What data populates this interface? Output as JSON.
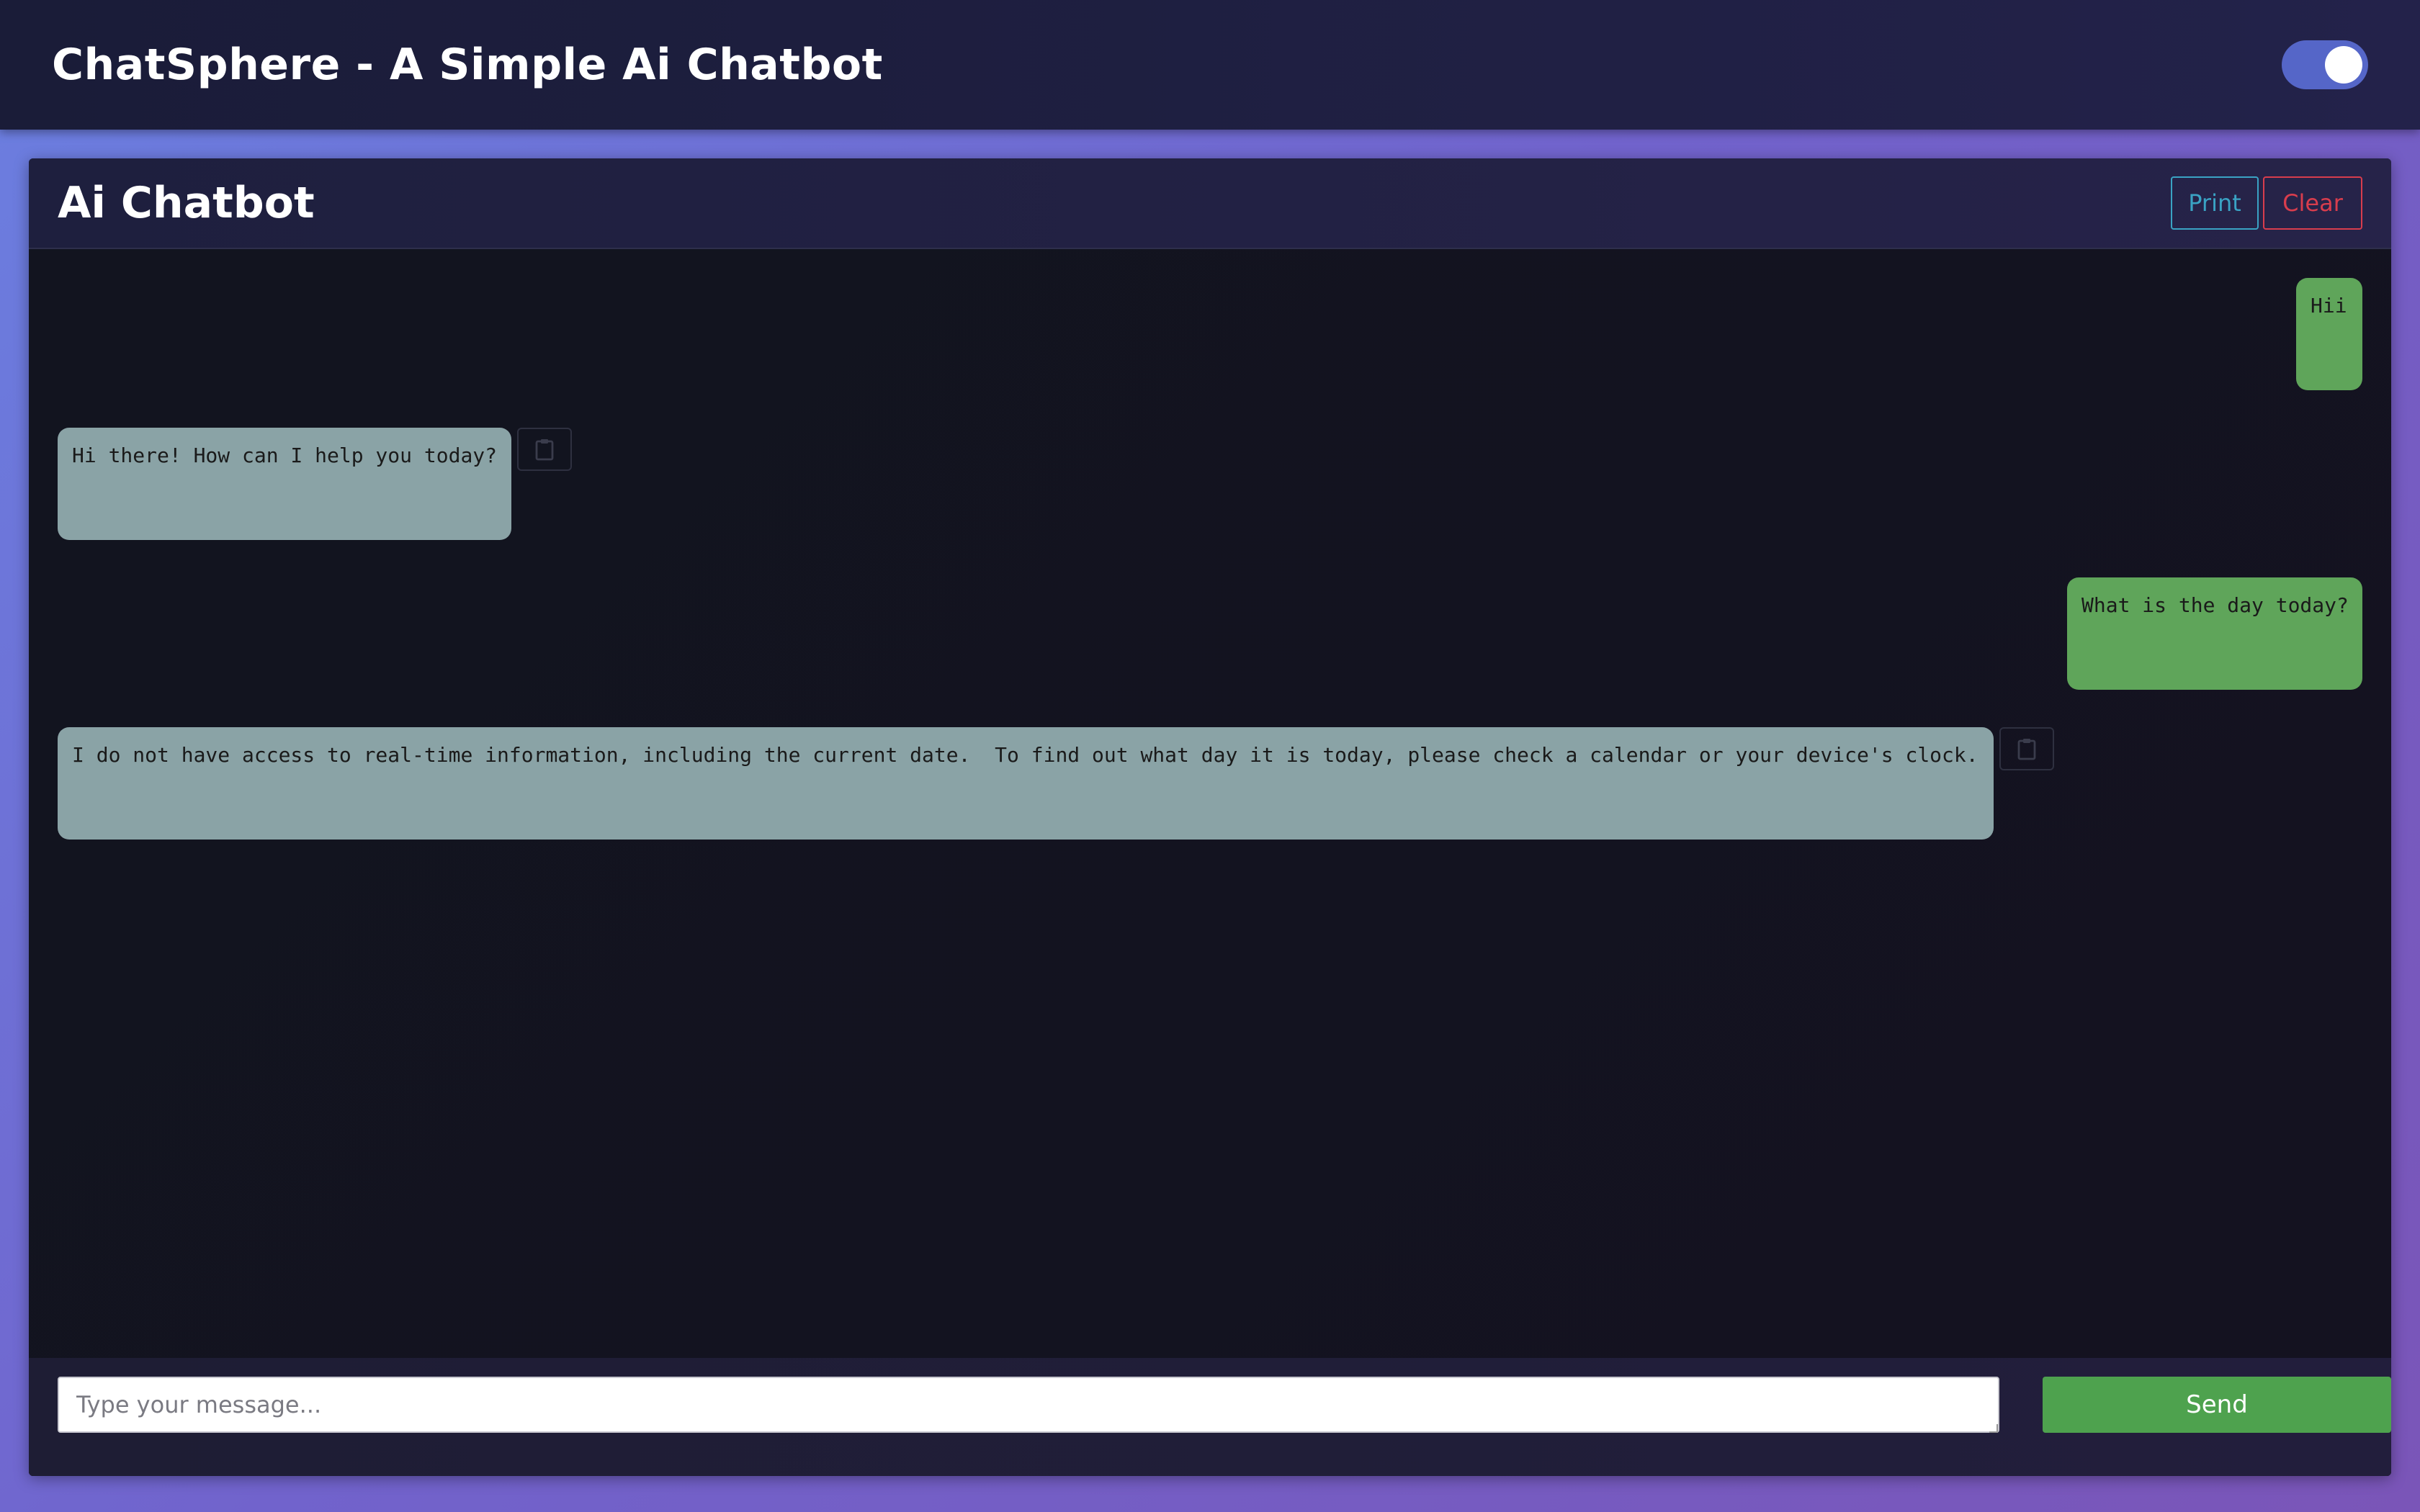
{
  "navbar": {
    "title": "ChatSphere - A Simple Ai Chatbot",
    "theme_toggle_on": true
  },
  "card": {
    "title": "Ai Chatbot",
    "print_label": "Print",
    "clear_label": "Clear"
  },
  "messages": [
    {
      "role": "user",
      "text": "Hii"
    },
    {
      "role": "bot",
      "text": "Hi there! How can I help you today?",
      "copy_icon": "clipboard-icon"
    },
    {
      "role": "user",
      "text": "What is the day today?"
    },
    {
      "role": "bot",
      "text": "I do not have access to real-time information, including the current date.  To find out what day it is today, please check a calendar or your device's clock.",
      "copy_icon": "clipboard-icon"
    }
  ],
  "composer": {
    "placeholder": "Type your message...",
    "value": "",
    "send_label": "Send"
  },
  "colors": {
    "user_bubble": "#5fa55a",
    "bot_bubble": "#8aa3a6",
    "send_button": "#4ea24e",
    "print_accent": "#3aa3c4",
    "clear_accent": "#d83d4d"
  }
}
